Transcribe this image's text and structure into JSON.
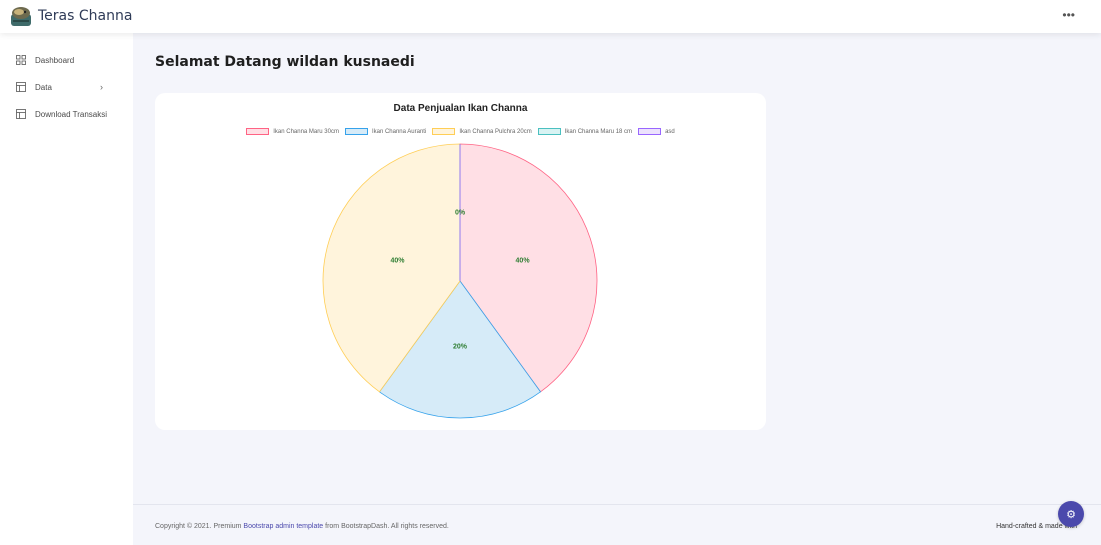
{
  "app": {
    "title": "Teras Channa",
    "more_icon": "more-horizontal-icon"
  },
  "sidebar": {
    "items": [
      {
        "label": "Dashboard",
        "icon": "grid-icon"
      },
      {
        "label": "Data",
        "icon": "layout-icon",
        "chevron": "›"
      },
      {
        "label": "Download Transaksi",
        "icon": "layout-icon"
      }
    ]
  },
  "main": {
    "welcome": "Selamat Datang wildan kusnaedi"
  },
  "chart_data": {
    "type": "pie",
    "title": "Data Penjualan Ikan Channa",
    "legend_position": "top",
    "categories": [
      "Ikan Channa Maru 30cm",
      "Ikan Channa Auranti",
      "Ikan Channa Pulchra 20cm",
      "Ikan Channa Maru 18 cm",
      "asd"
    ],
    "values": [
      40,
      20,
      40,
      0,
      0
    ],
    "data_labels": [
      "40%",
      "20%",
      "40%",
      "0%",
      "0%"
    ],
    "fill_colors": [
      "#ffdfe5",
      "#d6ebf8",
      "#fff4dc",
      "#d8f3f3",
      "#ece2fd"
    ],
    "border_colors": [
      "#ff6384",
      "#36a2eb",
      "#ffce56",
      "#4bc0c0",
      "#9966ff"
    ],
    "label_color": "#2e7d32"
  },
  "footer": {
    "copyright_prefix": "Copyright © 2021. Premium ",
    "link_text": "Bootstrap admin template",
    "copyright_suffix": " from BootstrapDash. All rights reserved.",
    "right_text": "Hand-crafted & made with"
  },
  "colors": {
    "accent": "#4b49ac",
    "background": "#f4f5fb"
  },
  "fab": {
    "icon": "settings-gear-icon",
    "glyph": "⚙"
  }
}
